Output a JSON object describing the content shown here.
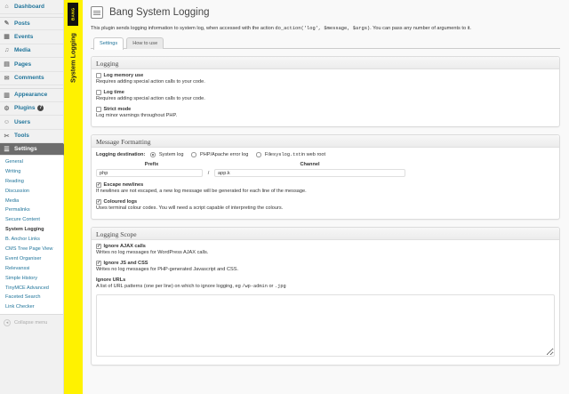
{
  "sidebar": {
    "top_items": [
      {
        "label": "Dashboard",
        "icon": "dashboard-icon"
      },
      {
        "label": "Posts",
        "icon": "pushpin-icon"
      },
      {
        "label": "Events",
        "icon": "calendar-icon"
      },
      {
        "label": "Media",
        "icon": "media-icon"
      },
      {
        "label": "Pages",
        "icon": "page-icon"
      },
      {
        "label": "Comments",
        "icon": "comment-icon"
      }
    ],
    "mid_items": [
      {
        "label": "Appearance",
        "icon": "appearance-icon"
      },
      {
        "label": "Plugins",
        "icon": "plugin-icon",
        "badge": "7"
      },
      {
        "label": "Users",
        "icon": "users-icon"
      },
      {
        "label": "Tools",
        "icon": "tools-icon"
      },
      {
        "label": "Settings",
        "icon": "settings-icon"
      }
    ],
    "settings_submenu": [
      "General",
      "Writing",
      "Reading",
      "Discussion",
      "Media",
      "Permalinks",
      "Secure Content",
      "System Logging",
      "B. Anchor Links",
      "CMS Tree Page View",
      "Event Organiser",
      "Relevanssi",
      "Simple History",
      "TinyMCE Advanced",
      "Faceted Search",
      "Link Checker"
    ],
    "active_submenu": "System Logging",
    "collapse_label": "Collapse menu"
  },
  "plugin_bar": {
    "logo_text": "BANG",
    "vertical_title": "System Logging",
    "color": "#fff200"
  },
  "page": {
    "title": "Bang System Logging",
    "intro_before": "This plugin sends logging information to system log, when accessed with the action ",
    "intro_code1": "do_action('log', $message, $args)",
    "intro_after": ". You can pass any number of arguments to it."
  },
  "tabs": [
    {
      "label": "Settings",
      "active": true
    },
    {
      "label": "How to use",
      "active": false
    }
  ],
  "logging_box": {
    "title": "Logging",
    "options": [
      {
        "label": "Log memory use",
        "checked": false,
        "desc": "Requires adding special action calls to your code."
      },
      {
        "label": "Log time",
        "checked": false,
        "desc": "Requires adding special action calls to your code."
      },
      {
        "label": "Strict mode",
        "checked": false,
        "desc": "Log minor warnings throughout PHP."
      }
    ]
  },
  "format_box": {
    "title": "Message Formatting",
    "destination_label": "Logging destination:",
    "destinations": {
      "system_log": "System log",
      "php_log": "PHP/Apache error log",
      "file_before": "File ",
      "file_code": "syslog.txt",
      "file_after": " in web root",
      "selected": "system_log"
    },
    "prefix_header": "Prefix",
    "channel_header": "Channel",
    "separator": "/",
    "prefix_value": "php",
    "channel_value": "app.k",
    "escape": {
      "label": "Escape newlines",
      "checked": true,
      "desc": "If newlines are not escaped, a new log message will be generated for each line of the message."
    },
    "colour": {
      "label": "Coloured logs",
      "checked": true,
      "desc": "Uses terminal colour codes. You will need a script capable of interpreting the colours."
    }
  },
  "scope_box": {
    "title": "Logging Scope",
    "ajax": {
      "label": "Ignore AJAX calls",
      "checked": true,
      "desc": "Writes no log messages for WordPress AJAX calls."
    },
    "jscss": {
      "label": "Ignore JS and CSS",
      "checked": true,
      "desc": "Writes no log messages for PHP-generated Javascript and CSS."
    },
    "urls_label": "Ignore URLs",
    "urls_desc_before": "A list of URL patterns (one per line) on which to ignore logging, eg ",
    "urls_code1": "/wp-admin",
    "urls_mid": " or ",
    "urls_code2": ".jpg",
    "urls_value": ""
  },
  "colors": {
    "link": "#21759b",
    "active_menu": "#6d6d6d",
    "plugin_yellow": "#fff200"
  }
}
